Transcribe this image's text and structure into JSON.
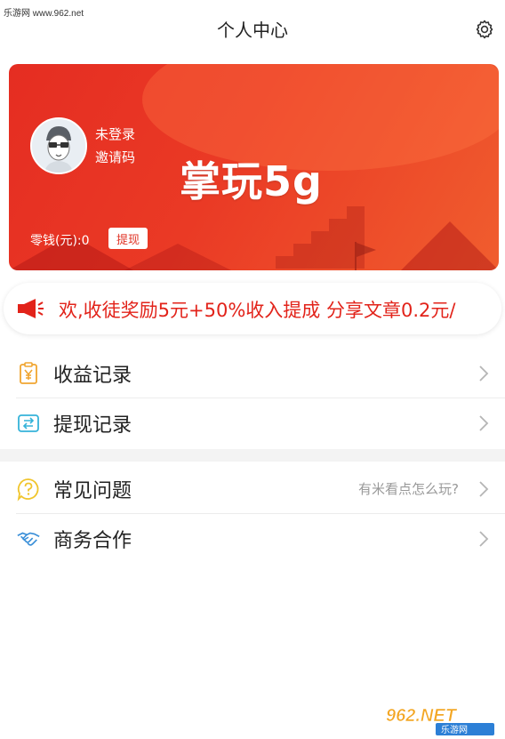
{
  "watermark_top": "乐游网 www.962.net",
  "header": {
    "title": "个人中心",
    "settings_icon": "gear-icon"
  },
  "profile": {
    "login_status": "未登录",
    "invite_label": "邀请码",
    "brand": "掌玩5g",
    "balance_label": "零钱(元):0",
    "withdraw_label": "提现",
    "accent": "#e52d22"
  },
  "notice": {
    "icon": "megaphone-icon",
    "text": "欢,收徒奖励5元+50%收入提成  分享文章0.2元/",
    "color": "#e2231a"
  },
  "menu_group_1": [
    {
      "label": "收益记录",
      "icon": "wallet-yen-icon"
    },
    {
      "label": "提现记录",
      "icon": "transfer-card-icon"
    }
  ],
  "menu_group_2": [
    {
      "label": "常见问题",
      "icon": "question-bubble-icon",
      "hint": "有米看点怎么玩?"
    },
    {
      "label": "商务合作",
      "icon": "handshake-icon"
    }
  ],
  "watermark_bottom": {
    "main": "962.NET",
    "sub": "乐游网"
  }
}
